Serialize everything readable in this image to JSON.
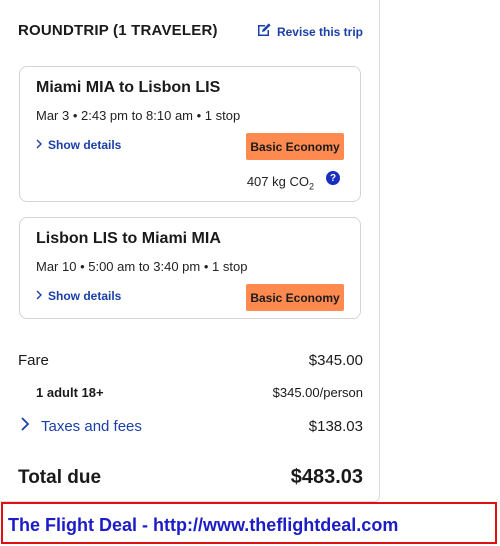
{
  "header": {
    "title": "ROUNDTRIP (1 TRAVELER)",
    "revise_label": "Revise this trip"
  },
  "legs": [
    {
      "route": "Miami MIA to Lisbon LIS",
      "time": "Mar 3 • 2:43 pm to 8:10 am • 1 stop",
      "details_label": "Show details",
      "fare_class": "Basic Economy",
      "co2_value": "407 kg CO",
      "co2_sub": "2"
    },
    {
      "route": "Lisbon LIS to Miami MIA",
      "time": "Mar 10 • 5:00 am to 3:40 pm • 1 stop",
      "details_label": "Show details",
      "fare_class": "Basic Economy"
    }
  ],
  "pricing": {
    "fare_label": "Fare",
    "fare_value": "$345.00",
    "adult_label": "1 adult 18+",
    "adult_value": "$345.00/person",
    "taxes_label": "Taxes and fees",
    "taxes_value": "$138.03",
    "total_label": "Total due",
    "total_value": "$483.03"
  },
  "banner": {
    "text": "The Flight Deal - http://www.theflightdeal.com"
  },
  "colors": {
    "link": "#1b3fa8",
    "badge": "#ff8a4f",
    "banner_border": "#e01010",
    "banner_text": "#1c1cc8"
  }
}
